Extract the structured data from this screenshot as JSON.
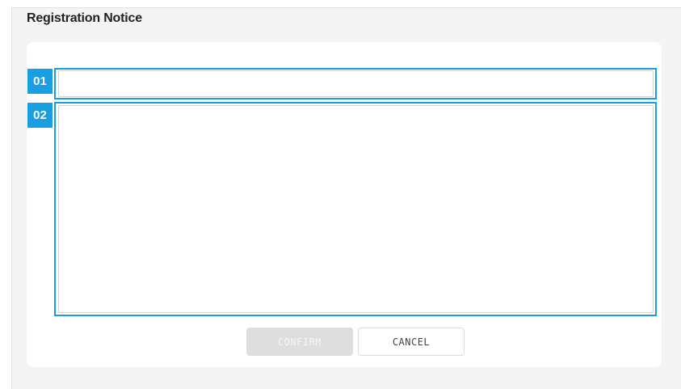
{
  "dialog": {
    "title": "Registration Notice",
    "markers": [
      "01",
      "02"
    ],
    "title_field": {
      "value": "",
      "placeholder": ""
    },
    "body_field": {
      "value": "",
      "placeholder": ""
    },
    "buttons": {
      "confirm": "CONFIRM",
      "cancel": "CANCEL"
    }
  },
  "colors": {
    "accent": "#1a9ee2",
    "background": "#f4f4f4",
    "card": "#ffffff",
    "confirm_disabled": "#dedede"
  }
}
